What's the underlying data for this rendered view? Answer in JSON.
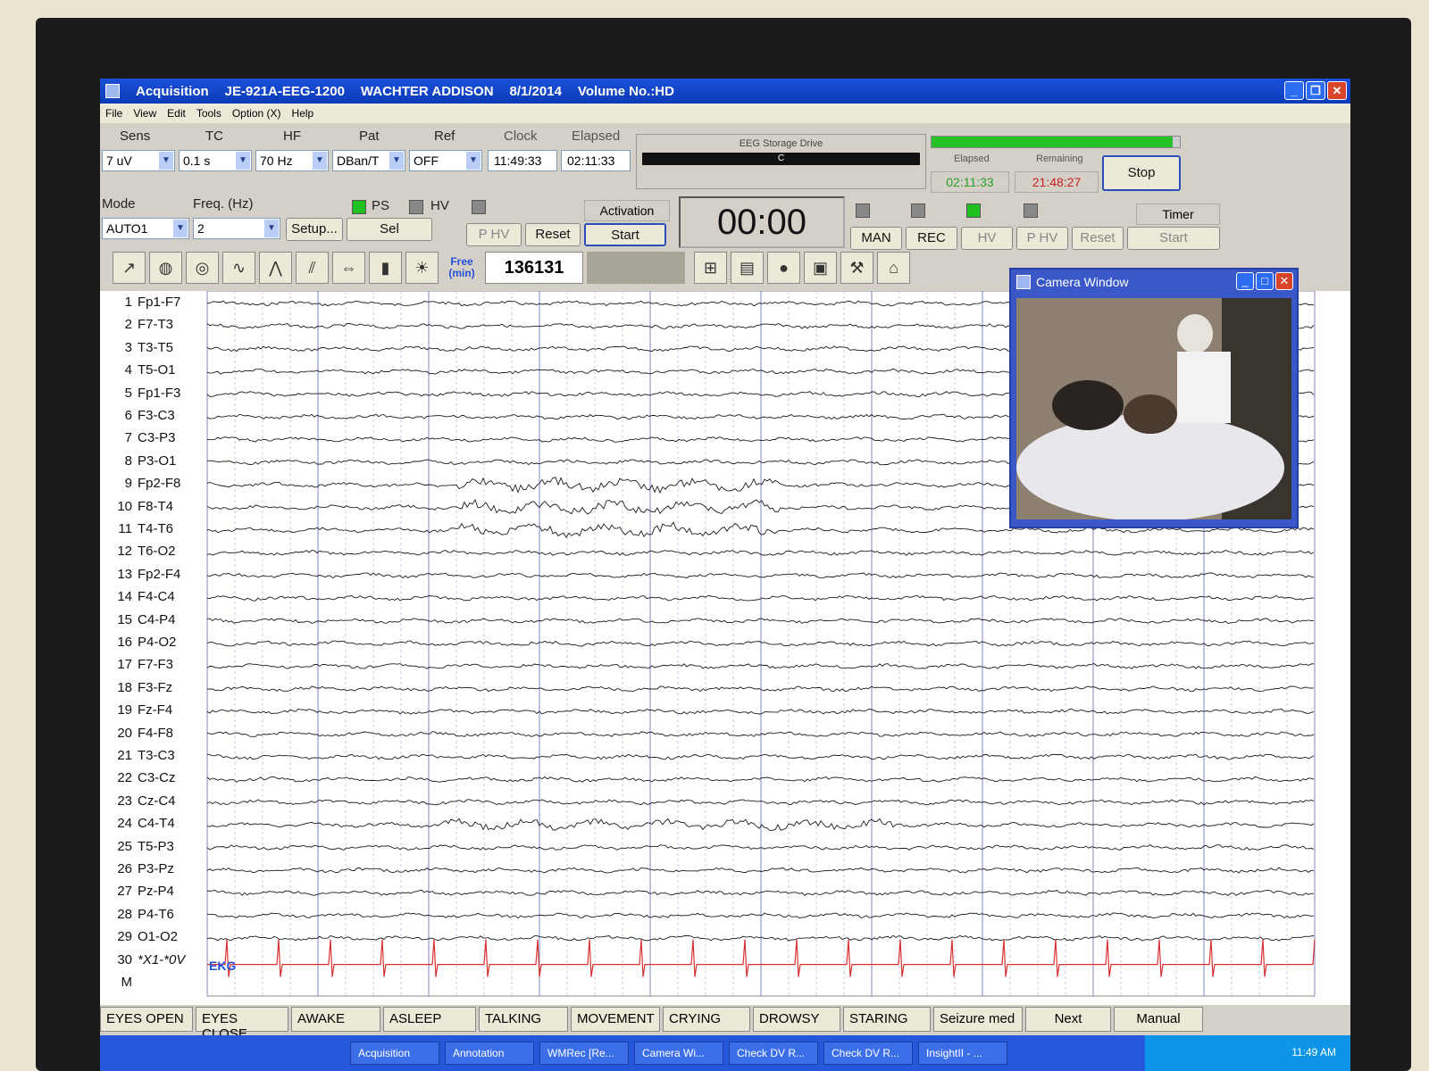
{
  "titlebar": {
    "app": "Acquisition",
    "device": "JE-921A-EEG-1200",
    "patient": "WACHTER ADDISON",
    "date": "8/1/2014",
    "volume": "Volume No.:HD"
  },
  "menu": [
    "File",
    "View",
    "Edit",
    "Tools",
    "Option (X)",
    "Help"
  ],
  "controls": {
    "sens_label": "Sens",
    "sens_value": "7 uV",
    "tc_label": "TC",
    "tc_value": "0.1 s",
    "hf_label": "HF",
    "hf_value": "70 Hz",
    "pat_label": "Pat",
    "pat_value": "DBan/T",
    "ref_label": "Ref",
    "ref_value": "OFF",
    "clock_label": "Clock",
    "clock_value": "11:49:33",
    "elapsed_label": "Elapsed",
    "elapsed_value": "02:11:33"
  },
  "storage": {
    "label": "EEG Storage Drive",
    "drive": "C",
    "progress": 0.97,
    "elapsed_label": "Elapsed",
    "elapsed_value": "02:11:33",
    "remaining_label": "Remaining",
    "remaining_value": "21:48:27",
    "stop_label": "Stop"
  },
  "mode": {
    "mode_label": "Mode",
    "mode_value": "AUTO1",
    "freq_label": "Freq. (Hz)",
    "freq_value": "2",
    "setup_label": "Setup...",
    "sel_label": "Sel",
    "ps_label": "PS",
    "hv_label": "HV",
    "activation_label": "Activation",
    "phv_label": "P HV",
    "reset_label": "Reset",
    "start_label": "Start"
  },
  "timer": {
    "display": "00:00",
    "timer_label": "Timer",
    "man_label": "MAN",
    "rec_label": "REC",
    "hv_label": "HV",
    "phv_label": "P HV",
    "reset_label": "Reset",
    "start_label": "Start"
  },
  "toolbar": {
    "free_label": "Free (min)",
    "free_value": "136131"
  },
  "channels": [
    {
      "n": "1",
      "name": "Fp1-F7"
    },
    {
      "n": "2",
      "name": "F7-T3"
    },
    {
      "n": "3",
      "name": "T3-T5"
    },
    {
      "n": "4",
      "name": "T5-O1"
    },
    {
      "n": "5",
      "name": "Fp1-F3"
    },
    {
      "n": "6",
      "name": "F3-C3"
    },
    {
      "n": "7",
      "name": "C3-P3"
    },
    {
      "n": "8",
      "name": "P3-O1"
    },
    {
      "n": "9",
      "name": "Fp2-F8"
    },
    {
      "n": "10",
      "name": "F8-T4"
    },
    {
      "n": "11",
      "name": "T4-T6"
    },
    {
      "n": "12",
      "name": "T6-O2"
    },
    {
      "n": "13",
      "name": "Fp2-F4"
    },
    {
      "n": "14",
      "name": "F4-C4"
    },
    {
      "n": "15",
      "name": "C4-P4"
    },
    {
      "n": "16",
      "name": "P4-O2"
    },
    {
      "n": "17",
      "name": "F7-F3"
    },
    {
      "n": "18",
      "name": "F3-Fz"
    },
    {
      "n": "19",
      "name": "Fz-F4"
    },
    {
      "n": "20",
      "name": "F4-F8"
    },
    {
      "n": "21",
      "name": "T3-C3"
    },
    {
      "n": "22",
      "name": "C3-Cz"
    },
    {
      "n": "23",
      "name": "Cz-C4"
    },
    {
      "n": "24",
      "name": "C4-T4"
    },
    {
      "n": "25",
      "name": "T5-P3"
    },
    {
      "n": "26",
      "name": "P3-Pz"
    },
    {
      "n": "27",
      "name": "Pz-P4"
    },
    {
      "n": "28",
      "name": "P4-T6"
    },
    {
      "n": "29",
      "name": "O1-O2"
    },
    {
      "n": "30",
      "name": "*X1-*0V"
    },
    {
      "n": "M",
      "name": ""
    }
  ],
  "ekg_label": "EKG",
  "camera": {
    "title": "Camera Window"
  },
  "events": [
    "EYES OPEN",
    "EYES CLOSE",
    "AWAKE",
    "ASLEEP",
    "TALKING",
    "MOVEMENT",
    "CRYING",
    "DROWSY",
    "STARING",
    "Seizure med",
    "Next",
    "Manual"
  ],
  "taskbar": {
    "tasks": [
      "Acquisition",
      "Annotation",
      "WMRec [Re...",
      "Camera Wi...",
      "Check DV R...",
      "Check DV R...",
      "InsightII - ..."
    ],
    "clock": "11:49 AM"
  },
  "colors": {
    "trace": "#1a1a1a",
    "ekg": "#d83030",
    "title_blue": "#0b3bb8",
    "accent_green": "#27c227",
    "remaining_red": "#c82020"
  }
}
